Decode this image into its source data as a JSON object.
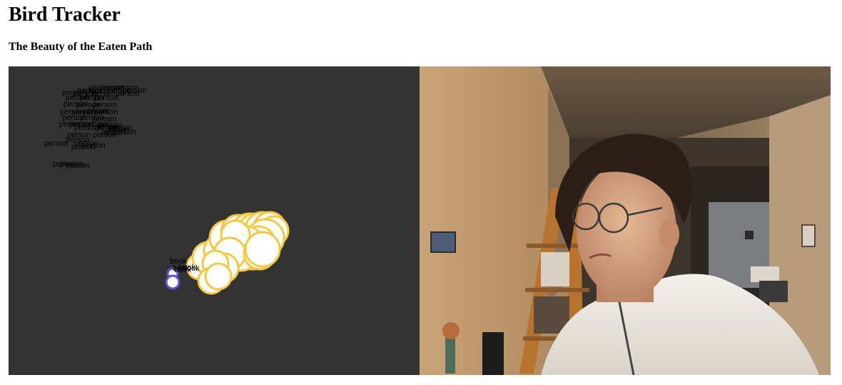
{
  "page": {
    "title": "Bird Tracker",
    "subtitle": "The Beauty of the Eaten Path"
  },
  "tracker": {
    "background": "#333333",
    "person_label": "person",
    "book_label": "book",
    "person_label_count": 46,
    "trail_fill": "#ffffff",
    "trail_stroke": "#f5c842",
    "book_marker_stroke": "#5a4fd6",
    "book_marker_count": 2,
    "trail_circle_count": 28
  },
  "webcam": {
    "description_icon": "webcam-feed"
  }
}
